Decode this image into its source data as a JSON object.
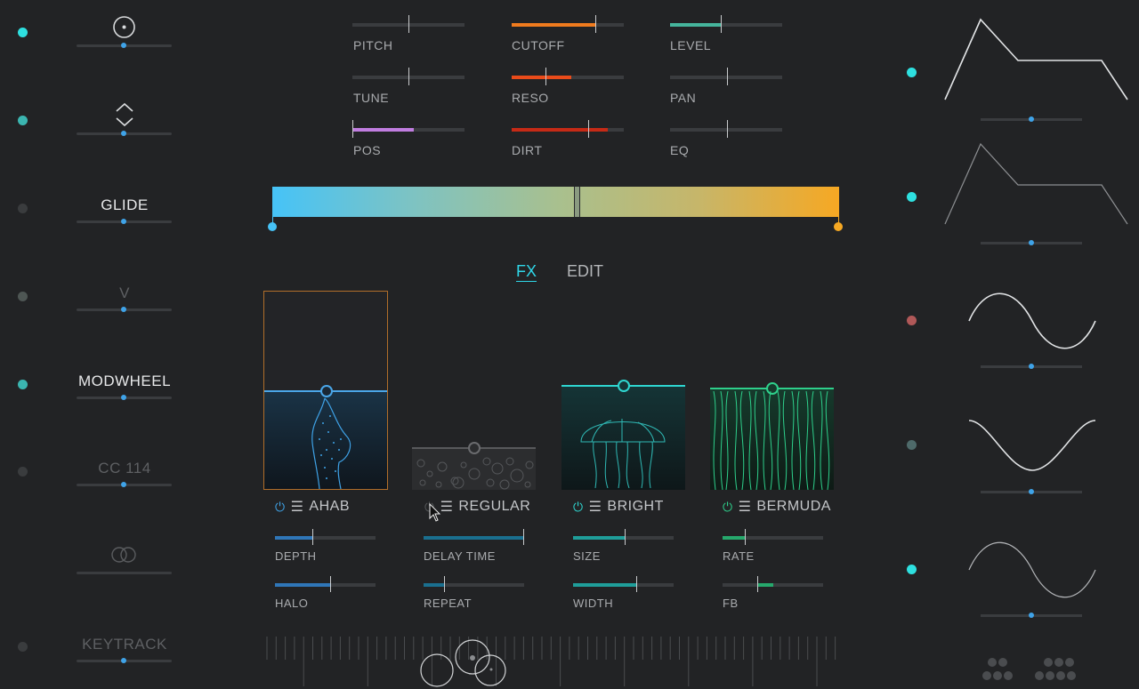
{
  "colors": {
    "bg": "#222325",
    "accent_blue": "#3fa3e8",
    "accent_cyan": "#2fd6d0",
    "accent_orange": "#f5a623",
    "accent_green": "#2ecf8b"
  },
  "sources": [
    {
      "label": "",
      "icon": "target-icon",
      "dot": "#2ee0e0",
      "knob": 0.5
    },
    {
      "label": "",
      "icon": "up-down-icon",
      "dot": "#3bb5b0",
      "knob": 0.5
    },
    {
      "label": "GLIDE",
      "icon": "",
      "dot": "#3a3c3e",
      "knob": 0.5
    },
    {
      "label": "V",
      "icon": "",
      "dot": "#4e5654",
      "knob": 0.5
    },
    {
      "label": "MODWHEEL",
      "icon": "",
      "dot": "#3bb5b0",
      "knob": 0.5
    },
    {
      "label": "CC 114",
      "icon": "",
      "dot": "#3a3c3e",
      "knob": 0.5
    },
    {
      "label": "",
      "icon": "overlap-circles-icon",
      "dot": "",
      "knob": null
    },
    {
      "label": "KEYTRACK",
      "icon": "",
      "dot": "#3a3c3e",
      "knob": 0.5
    }
  ],
  "params": [
    {
      "label": "PITCH",
      "fill": 0,
      "fill_color": "",
      "mark": 0.5
    },
    {
      "label": "CUTOFF",
      "fill": 0.75,
      "fill_color": "#f07b1e",
      "mark": 0.75
    },
    {
      "label": "LEVEL",
      "fill": 0.45,
      "fill_color": "#45b59c",
      "mark": 0.45
    },
    {
      "label": "TUNE",
      "fill": 0,
      "fill_color": "",
      "mark": 0.5
    },
    {
      "label": "RESO",
      "fill": 0.53,
      "fill_color": "#ea4b1a",
      "mark": 0.3
    },
    {
      "label": "PAN",
      "fill": 0,
      "fill_color": "",
      "mark": 0.5
    },
    {
      "label": "POS",
      "fill": 0.54,
      "fill_color": "#c07de0",
      "mark": 0.0
    },
    {
      "label": "DIRT",
      "fill": 0.85,
      "fill_color": "#c62a16",
      "mark": 0.68
    },
    {
      "label": "EQ",
      "fill": 0,
      "fill_color": "",
      "mark": 0.5
    }
  ],
  "morph_position": 0.54,
  "tabs": {
    "fx": "FX",
    "edit": "EDIT"
  },
  "fx": [
    {
      "name": "AHAB",
      "power_color": "#3fa3e8",
      "level": 0.2,
      "p1_label": "DEPTH",
      "p1_fill": 0.37,
      "p1_color": "#2f76b8",
      "p2_label": "HALO",
      "p2_fill": 0.55,
      "p2_color": "#2f76b8"
    },
    {
      "name": "REGULAR",
      "power_color": "#555759",
      "level": 0.25,
      "p1_label": "DELAY TIME",
      "p1_fill": 1.0,
      "p1_color": "#1a6f8f",
      "p2_label": "REPEAT",
      "p2_fill": 0.2,
      "p2_color": "#1a6f8f"
    },
    {
      "name": "BRIGHT",
      "power_color": "#2fd6d0",
      "level": 0.0,
      "p1_label": "SIZE",
      "p1_fill": 0.5,
      "p1_color": "#1f9e9a",
      "p2_label": "WIDTH",
      "p2_fill": 0.63,
      "p2_color": "#1f9e9a"
    },
    {
      "name": "BERMUDA",
      "power_color": "#2ecf8b",
      "level": 0.0,
      "p1_label": "RATE",
      "p1_fill": 0.22,
      "p1_color": "#26a86c",
      "p2_label": "FB",
      "p2_fill": 0.45,
      "p2_color": "#26a86c"
    }
  ],
  "mod_shapes": [
    {
      "icon": "envelope-icon",
      "dot": "#2ee0e0",
      "knob": 0.5
    },
    {
      "icon": "envelope-icon",
      "dot": "#2ee0e0",
      "knob": 0.5
    },
    {
      "icon": "sine-icon",
      "dot": "#b05858",
      "knob": 0.5
    },
    {
      "icon": "inverted-sine-icon",
      "dot": "#4e6a6a",
      "knob": 0.5
    },
    {
      "icon": "sine-icon",
      "dot": "#2ee0e0",
      "knob": 0.5
    }
  ]
}
